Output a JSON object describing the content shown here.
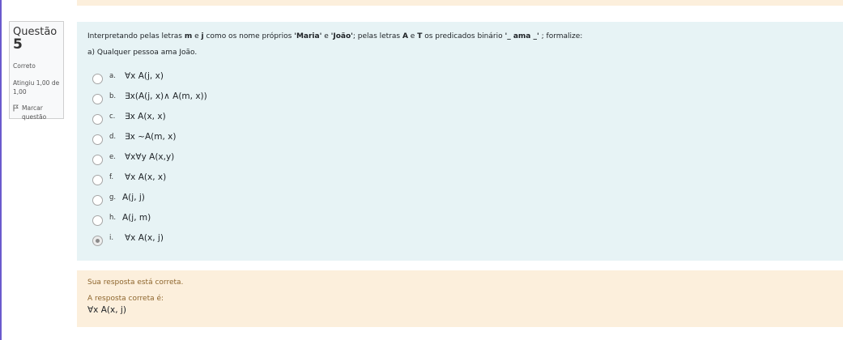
{
  "info": {
    "question_label": "Questão",
    "question_number": "5",
    "state": "Correto",
    "grade": "Atingiu 1,00 de 1,00",
    "flag_label": "Marcar questão",
    "flag_icon": "flag-icon"
  },
  "question": {
    "text_parts": [
      "Interpretando pelas letras ",
      "m",
      " e ",
      "j",
      " como os nome próprios ",
      "'Maria'",
      " e ",
      "'João'",
      "; pelas letras ",
      "A",
      " e ",
      "T",
      " os predicados binário ",
      "'_ ama _'",
      " ;  formalize:"
    ],
    "prompt": "a) Qualquer pessoa ama João."
  },
  "options": [
    {
      "letter": "a.",
      "text": "∀x A(j, x)",
      "checked": false
    },
    {
      "letter": "b.",
      "text": "∃x(A(j, x)∧ A(m, x))",
      "checked": false
    },
    {
      "letter": "c.",
      "text": "∃x A(x, x)",
      "checked": false
    },
    {
      "letter": "d.",
      "text": "∃x ~A(m, x)",
      "checked": false
    },
    {
      "letter": "e.",
      "text": "∀x∀y A(x,y)",
      "checked": false
    },
    {
      "letter": "f.",
      "text": "∀x A(x, x)",
      "checked": false
    },
    {
      "letter": "g.",
      "text": "A(j, j)",
      "checked": false
    },
    {
      "letter": "h.",
      "text": "A(j, m)",
      "checked": false
    },
    {
      "letter": "i.",
      "text": "∀x A(x, j)",
      "checked": true
    }
  ],
  "outcome": {
    "feedback": "Sua resposta está correta.",
    "right_answer_label": "A resposta correta é:",
    "right_answer": "∀x A(x, j)"
  },
  "colors": {
    "accent": "#6a5acd",
    "formulation_bg": "#e7f3f5",
    "outcome_bg": "#fcefdc",
    "outcome_text": "#8e662e"
  }
}
